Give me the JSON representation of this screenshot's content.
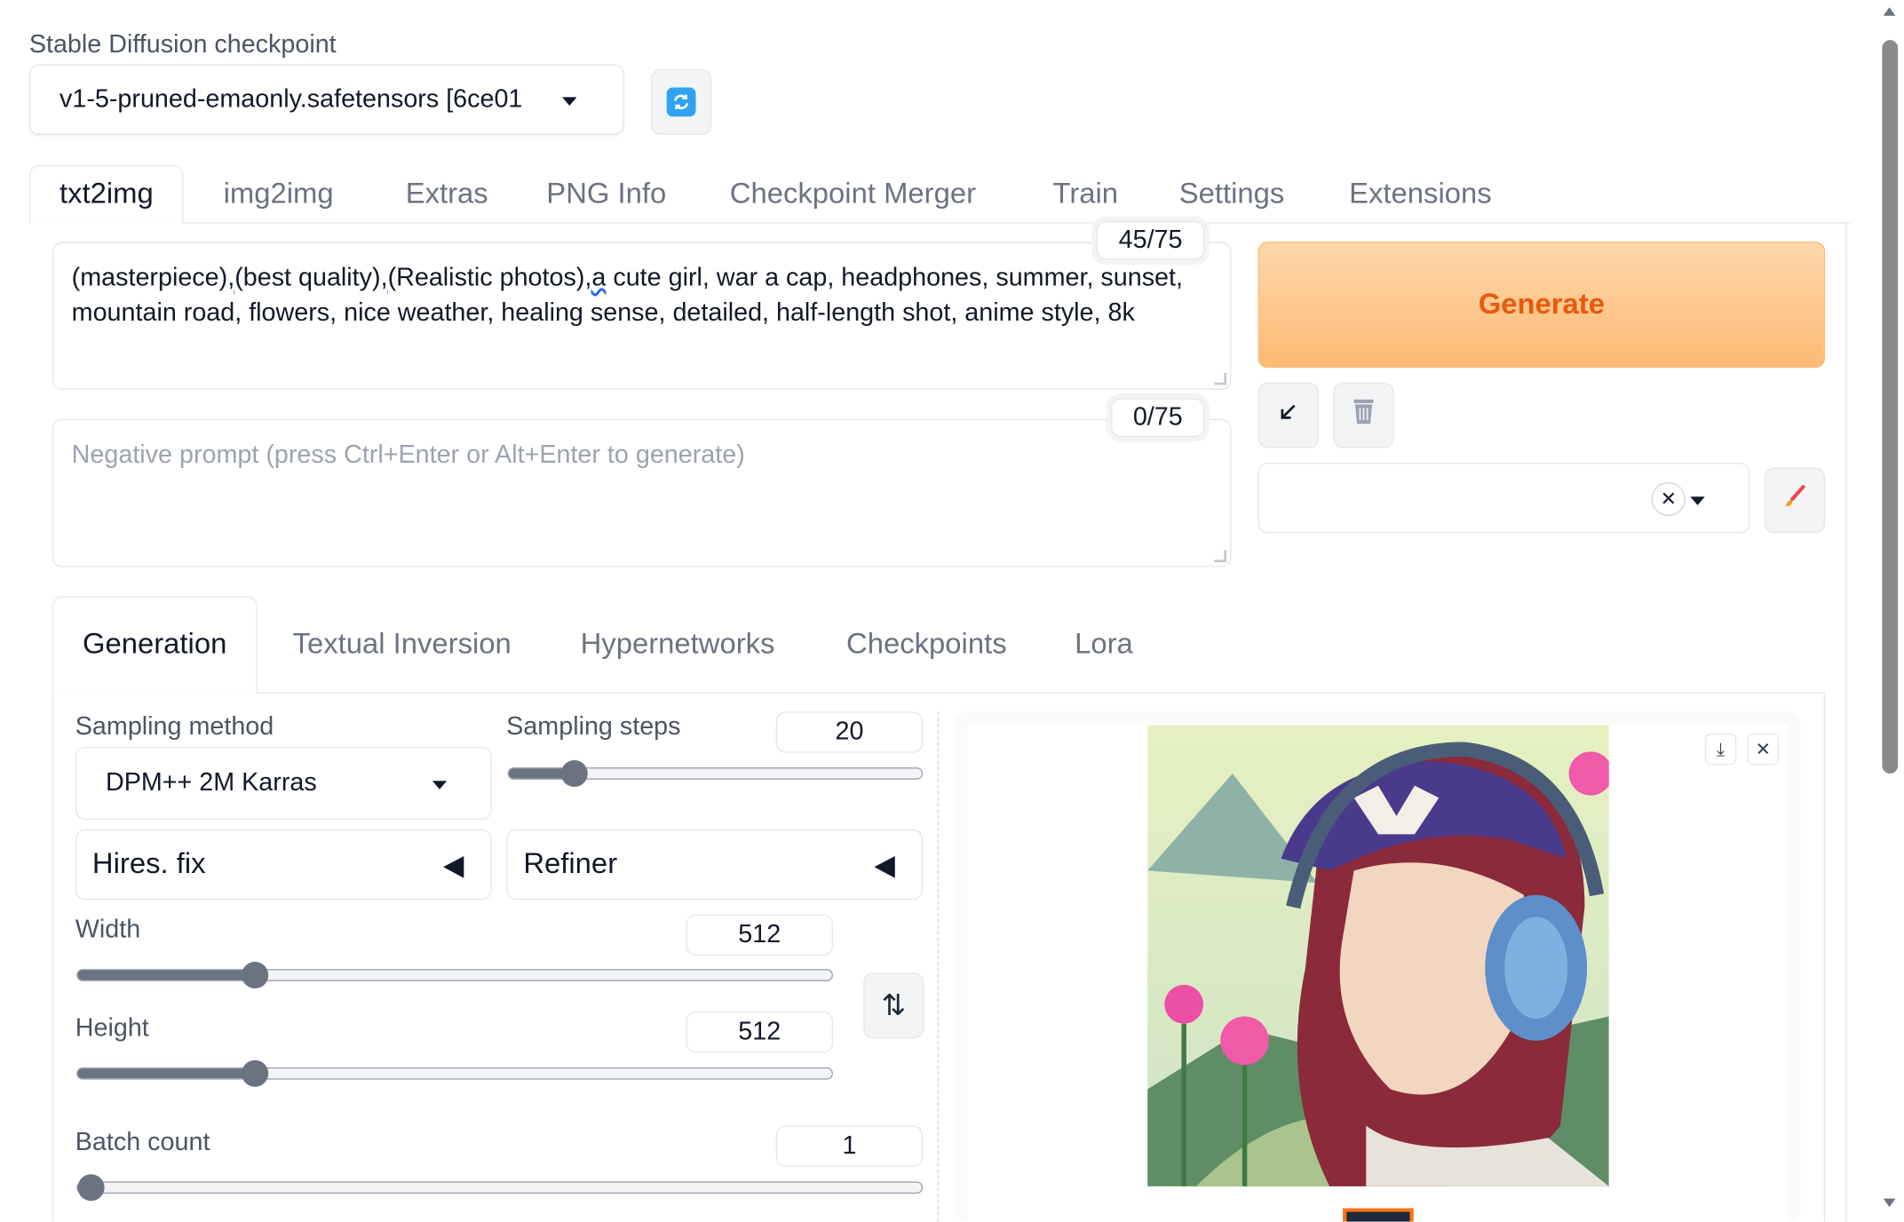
{
  "checkpoint": {
    "label": "Stable Diffusion checkpoint",
    "value": "v1-5-pruned-emaonly.safetensors [6ce01",
    "refresh_icon": "refresh-icon"
  },
  "top_tabs": [
    "txt2img",
    "img2img",
    "Extras",
    "PNG Info",
    "Checkpoint Merger",
    "Train",
    "Settings",
    "Extensions"
  ],
  "prompt": {
    "parts": [
      "(masterpiece)",
      ",",
      "(best quality)",
      ",",
      "(Realistic photos)",
      ",",
      "a",
      " cute girl, war a cap, headphones, summer, sunset, mountain road, flowers, nice weather, healing sense, detailed, half-length shot, anime style, 8k"
    ],
    "counter": "45/75"
  },
  "negative_prompt": {
    "placeholder": "Negative prompt (press Ctrl+Enter or Alt+Enter to generate)",
    "value": "",
    "counter": "0/75"
  },
  "actions": {
    "generate_label": "Generate",
    "read_params_icon": "arrow-down-left-icon",
    "trash_icon": "trash-icon",
    "styles_clear_icon": "close-icon",
    "edit_style_icon": "brush-icon"
  },
  "gen_tabs": [
    "Generation",
    "Textual Inversion",
    "Hypernetworks",
    "Checkpoints",
    "Lora"
  ],
  "generation": {
    "sampling_method_label": "Sampling method",
    "sampling_method": "DPM++ 2M Karras",
    "sampling_steps_label": "Sampling steps",
    "sampling_steps": "20",
    "hires_label": "Hires. fix",
    "refiner_label": "Refiner",
    "width_label": "Width",
    "width": "512",
    "height_label": "Height",
    "height": "512",
    "batch_count_label": "Batch count",
    "batch_count": "1"
  },
  "sliders": {
    "sampling_steps": 0.16,
    "width": 0.235,
    "height": 0.235,
    "batch_count": 0.0
  },
  "colors": {
    "accent": "#ea580c",
    "generate_bg": "#fdba74",
    "slider": "#6b7280"
  }
}
